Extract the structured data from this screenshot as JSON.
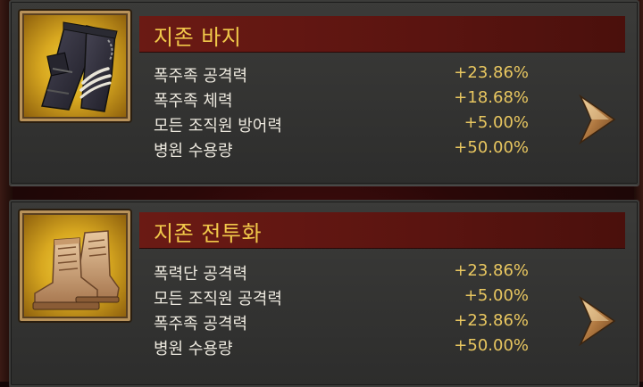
{
  "items": [
    {
      "name": "지존 바지",
      "icon": "pants-icon",
      "stats": [
        {
          "label": "폭주족 공격력",
          "value": "+23.86%"
        },
        {
          "label": "폭주족 체력",
          "value": "+18.68%"
        },
        {
          "label": "모든 조직원 방어력",
          "value": "+5.00%"
        },
        {
          "label": "병원 수용량",
          "value": "+50.00%"
        }
      ]
    },
    {
      "name": "지존 전투화",
      "icon": "boots-icon",
      "stats": [
        {
          "label": "폭력단 공격력",
          "value": "+23.86%"
        },
        {
          "label": "모든 조직원 공격력",
          "value": "+5.00%"
        },
        {
          "label": "폭주족 공격력",
          "value": "+23.86%"
        },
        {
          "label": "병원 수용량",
          "value": "+50.00%"
        }
      ]
    }
  ],
  "colors": {
    "title": "#f1c84a",
    "value": "#e9c760",
    "label": "#ece8de",
    "title_bar": "#6b1a14",
    "icon_bg": "#e0b028"
  }
}
